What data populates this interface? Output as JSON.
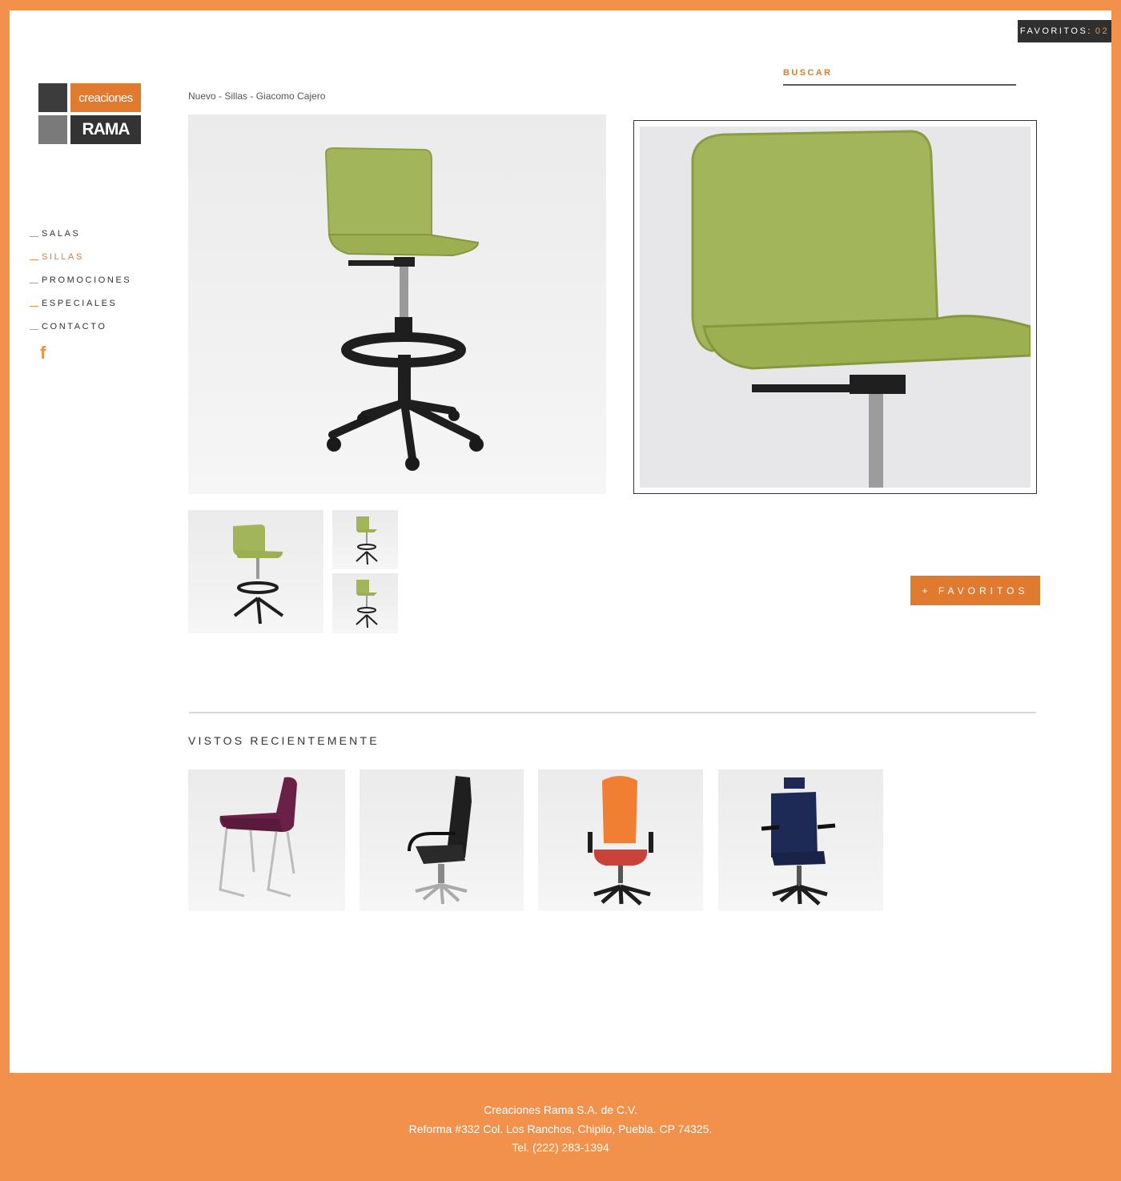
{
  "header": {
    "favorites_label": "FAVORITOS:",
    "favorites_count": "02",
    "search_label": "BUSCAR"
  },
  "logo": {
    "line1": "creaciones",
    "line2": "RAMA"
  },
  "nav": {
    "items": [
      {
        "label": "SALAS"
      },
      {
        "label": "SILLAS"
      },
      {
        "label": "PROMOCIONES"
      },
      {
        "label": "ESPECIALES"
      },
      {
        "label": "CONTACTO"
      }
    ],
    "active": "SILLAS",
    "social_icon": "facebook-icon"
  },
  "product": {
    "breadcrumb": "Nuevo - Sillas - Giacomo Cajero",
    "add_favorite_label": "+ FAVORITOS"
  },
  "recent": {
    "title": "VISTOS RECIENTEMENTE"
  },
  "footer": {
    "company": "Creaciones Rama S.A. de C.V.",
    "address": "Reforma #332 Col. Los Ranchos, Chipilo, Puebla. CP 74325.",
    "phone": "Tel. (222) 283-1394"
  },
  "colors": {
    "accent": "#f2914b",
    "accent_dark": "#e07a2e",
    "dark": "#2f2f2f",
    "seat_green": "#a3b55a"
  }
}
